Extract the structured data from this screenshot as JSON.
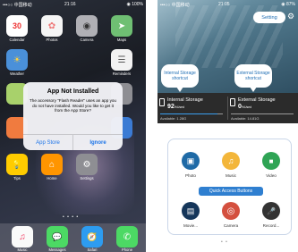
{
  "left_screen": {
    "status": {
      "carrier": "•••○○ 中国移动",
      "time": "21:16",
      "battery": "◉ 100%"
    },
    "apps_row1": [
      {
        "label": "Calendar",
        "glyph": "30",
        "color": "#ffffff"
      },
      {
        "label": "Photos",
        "glyph": "✿",
        "color": "#f5f5f5"
      },
      {
        "label": "Camera",
        "glyph": "◉",
        "color": "#b0b0b5"
      },
      {
        "label": "Maps",
        "glyph": "➤",
        "color": "#6fbf73"
      }
    ],
    "apps_row2": [
      {
        "label": "Weather",
        "glyph": "☀",
        "color": "#4a90d9"
      },
      {
        "label": "",
        "glyph": "",
        "color": "#d0d0d0"
      },
      {
        "label": "",
        "glyph": "",
        "color": "#ffcc33"
      },
      {
        "label": "Reminders",
        "glyph": "☰",
        "color": "#f2f2f2"
      }
    ],
    "apps_row3": [
      {
        "label": "",
        "glyph": "",
        "color": "#a8d16b"
      },
      {
        "label": "",
        "glyph": "",
        "color": "#f07b3f"
      },
      {
        "label": "",
        "glyph": "",
        "color": "#3b7bd4"
      },
      {
        "label": "",
        "glyph": "",
        "color": "#8e8e93"
      }
    ],
    "apps_row5": [
      {
        "label": "Tips",
        "glyph": "💡",
        "color": "#ffcc00"
      },
      {
        "label": "Home",
        "glyph": "⌂",
        "color": "#ff9500"
      },
      {
        "label": "Settings",
        "glyph": "⚙",
        "color": "#8e8e93"
      },
      {
        "label": "",
        "glyph": "",
        "color": "rgba(0,0,0,0)"
      }
    ],
    "dock": [
      {
        "label": "Music",
        "glyph": "♫",
        "color": "#fafafa"
      },
      {
        "label": "Messages",
        "glyph": "💬",
        "color": "#4cd964"
      },
      {
        "label": "Safari",
        "glyph": "🧭",
        "color": "#2d9cf0"
      },
      {
        "label": "Phone",
        "glyph": "✆",
        "color": "#4cd964"
      }
    ],
    "alert": {
      "title": "App Not Installed",
      "message": "The accessory \"Flash Reader\" uses an app you do not have installed. Would you like to get it from the App Store?",
      "btn_left": "App Store",
      "btn_right": "Ignore"
    },
    "page_dots": "• • • •"
  },
  "right_screen": {
    "status": {
      "carrier": "•••○○ 中国移动",
      "time": "21:05",
      "battery": "◉ 87%"
    },
    "setting_label": "Setting",
    "bubble_internal": "Internal Storage shortcut",
    "bubble_external": "External Storage shortcut",
    "internal": {
      "title": "Internal Storage",
      "value": "92",
      "unit": "%Used",
      "available": "Available: 1.28G",
      "fill": 0.92
    },
    "external": {
      "title": "External Storage",
      "value": "0",
      "unit": "%Used",
      "available": "Available: 14.81G",
      "fill": 0.0
    },
    "quick_access_label": "Quick Access Buttons",
    "buttons_top": [
      {
        "label": "Photo",
        "glyph": "▣",
        "color": "#1f6aa6"
      },
      {
        "label": "Music",
        "glyph": "♫",
        "color": "#f3b63a"
      },
      {
        "label": "Video",
        "glyph": "■",
        "color": "#2fa455"
      }
    ],
    "buttons_bottom": [
      {
        "label": "Movie...",
        "glyph": "▤",
        "color": "#15365a"
      },
      {
        "label": "Camera",
        "glyph": "◎",
        "color": "#d4503f"
      },
      {
        "label": "Record...",
        "glyph": "🎤",
        "color": "#333333"
      }
    ],
    "page_dots": "• •"
  }
}
